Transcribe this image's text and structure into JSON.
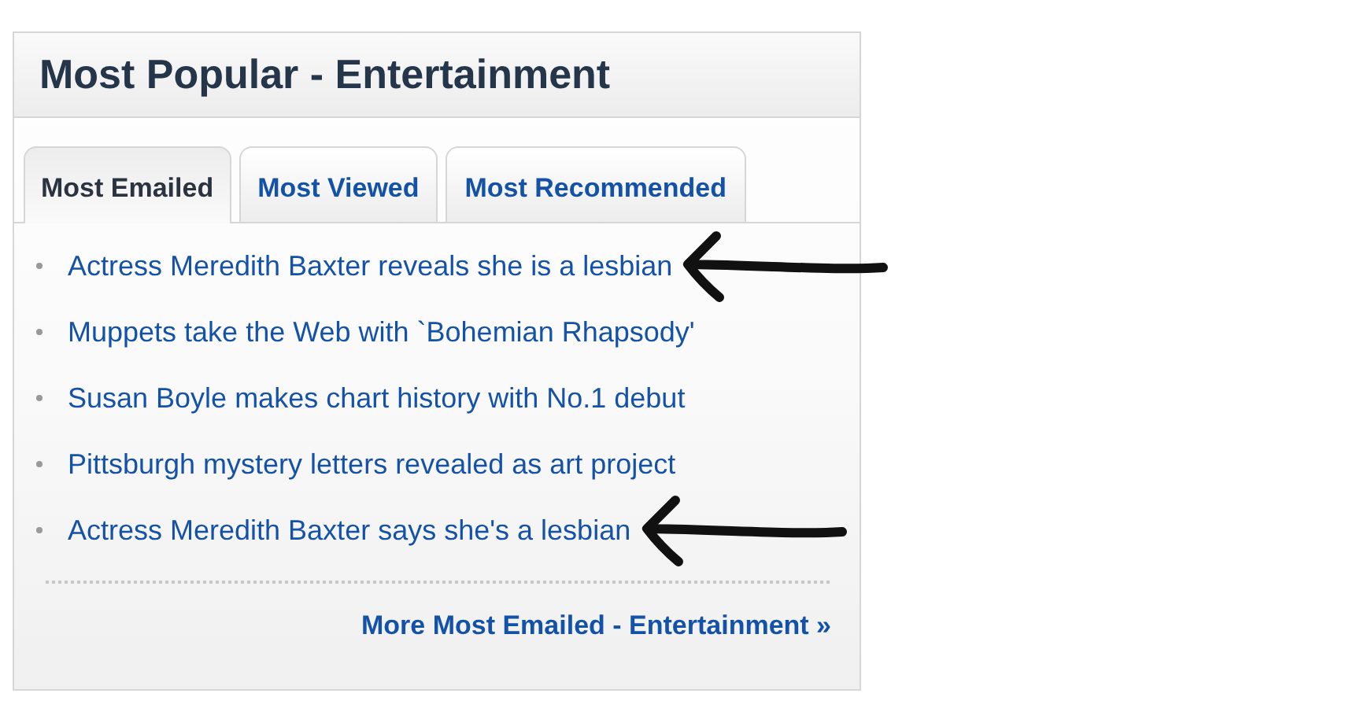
{
  "widget": {
    "title": "Most Popular - Entertainment",
    "tabs": [
      {
        "label": "Most Emailed",
        "selected": true
      },
      {
        "label": "Most Viewed",
        "selected": false
      },
      {
        "label": "Most Recommended",
        "selected": false
      }
    ],
    "items": [
      {
        "text": "Actress Meredith Baxter reveals she is a lesbian",
        "marked": true
      },
      {
        "text": "Muppets take the Web with `Bohemian Rhapsody'",
        "marked": false
      },
      {
        "text": "Susan Boyle makes chart history with No.1 debut",
        "marked": false
      },
      {
        "text": "Pittsburgh mystery letters revealed as art project",
        "marked": false
      },
      {
        "text": "Actress Meredith Baxter says she's a lesbian",
        "marked": true
      }
    ],
    "more_link": "More Most Emailed - Entertainment »"
  }
}
